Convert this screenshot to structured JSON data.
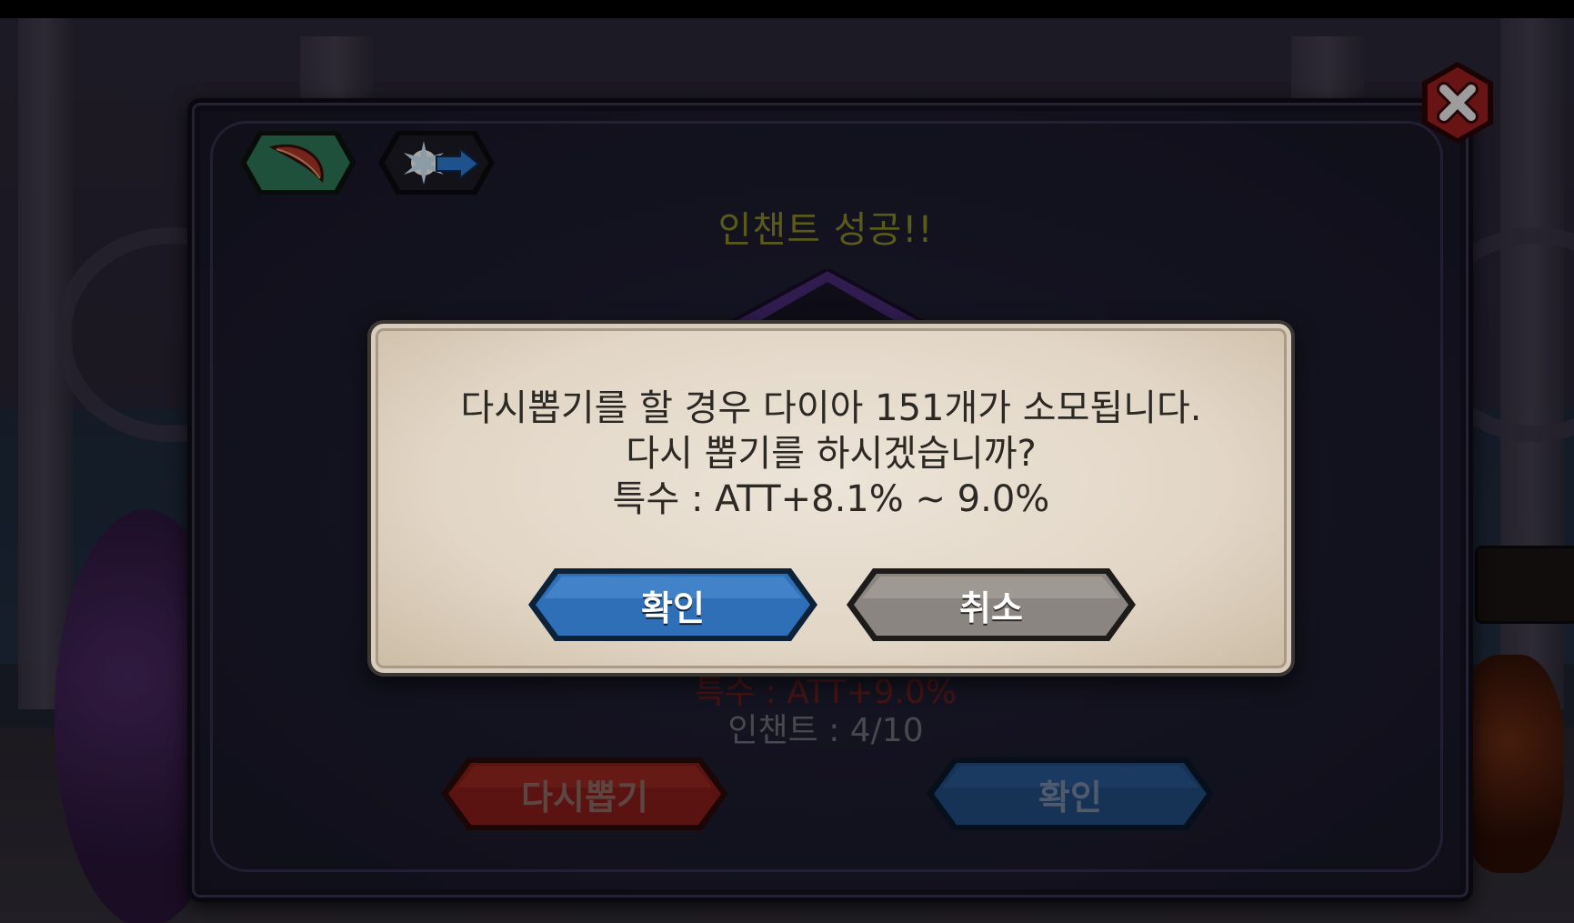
{
  "background": {
    "status_effect": "특수 : ATT+9.0%",
    "enchant_count": "인챈트 : 4/10"
  },
  "dialog": {
    "title": "인챈트 성공!!",
    "tabs": [
      {
        "icon": "feather-icon",
        "color": "#2f7b5c"
      },
      {
        "icon": "star-burst-arrow-icon",
        "color": "#1a1a24"
      }
    ],
    "reroll_button": "다시뽑기",
    "confirm_button": "확인"
  },
  "modal": {
    "line1": "다시뽑기를 할 경우 다이아 151개가 소모됩니다.",
    "line2": "다시 뽑기를 하시겠습니까?",
    "line3": "특수 : ATT+8.1% ~ 9.0%",
    "confirm_button": "확인",
    "cancel_button": "취소"
  },
  "colors": {
    "title": "#8b8a2a",
    "confirm_blue": "#2e6fb8",
    "cancel_grey": "#8a8580",
    "reroll_red": "#8a1e1a",
    "close_red": "#a02020"
  }
}
